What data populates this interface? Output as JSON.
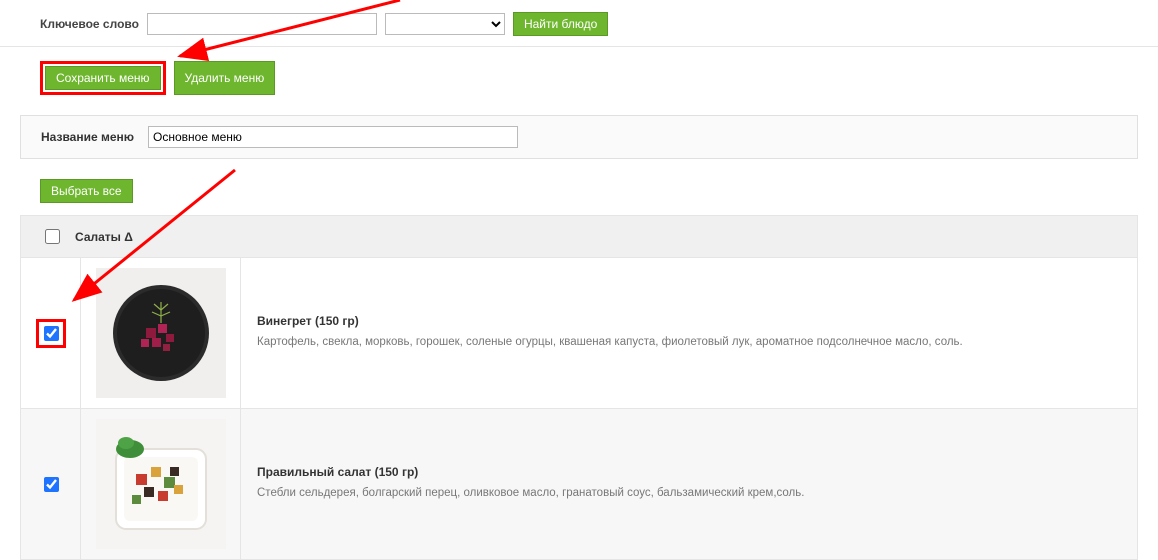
{
  "search": {
    "label": "Ключевое слово",
    "keyword_value": "",
    "select_value": "",
    "find_button": "Найти блюдо"
  },
  "actions": {
    "save_menu": "Сохранить меню",
    "delete_menu": "Удалить меню"
  },
  "menu_name": {
    "label": "Название меню",
    "value": "Основное меню"
  },
  "select_all_button": "Выбрать все",
  "category": {
    "checked": false,
    "label": "Салаты Δ"
  },
  "dishes": [
    {
      "checked": true,
      "title": "Винегрет (150 гр)",
      "desc": "Картофель, свекла, морковь, горошек, соленые огурцы, квашеная капуста, фиолетовый лук, ароматное подсолнечное масло, соль."
    },
    {
      "checked": true,
      "title": "Правильный салат (150 гр)",
      "desc": "Стебли сельдерея, болгарский перец, оливковое масло, гранатовый соус, бальзамический крем,соль."
    }
  ],
  "colors": {
    "accent_green": "#6fb62f",
    "highlight_red": "#ff0000",
    "checkbox_blue": "#1e73ff"
  }
}
